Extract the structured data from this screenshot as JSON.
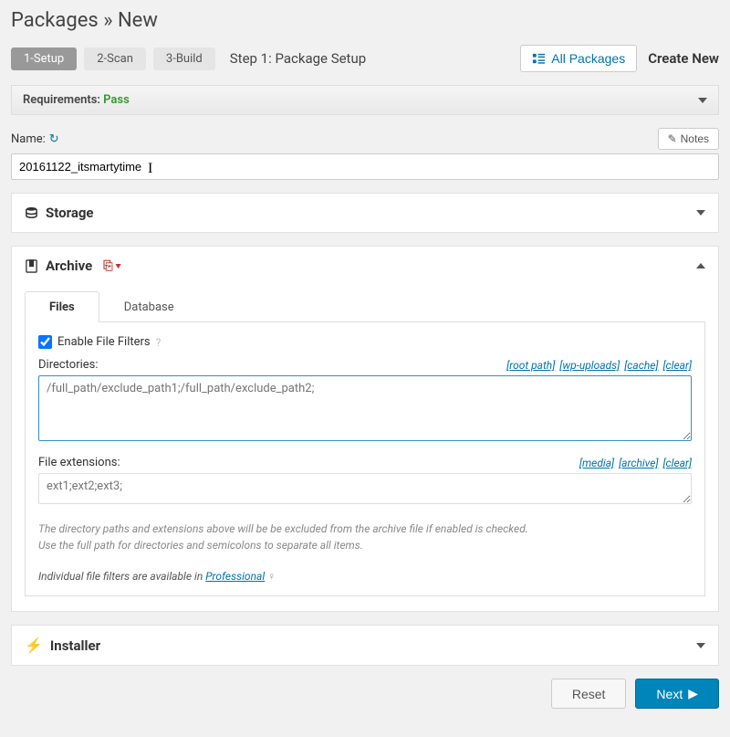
{
  "header": {
    "breadcrumb_root": "Packages",
    "breadcrumb_sep": "»",
    "breadcrumb_leaf": "New",
    "all_packages": "All Packages",
    "create_new": "Create New"
  },
  "steps": {
    "s1": "1-Setup",
    "s2": "2-Scan",
    "s3": "3-Build",
    "label": "Step 1: Package Setup"
  },
  "requirements": {
    "label": "Requirements: ",
    "status": "Pass"
  },
  "name": {
    "label": "Name:",
    "value": "20161122_itsmartytime",
    "notes_btn": "Notes"
  },
  "storage": {
    "title": "Storage"
  },
  "archive": {
    "title": "Archive",
    "tabs": {
      "files": "Files",
      "database": "Database"
    },
    "enable_filters": "Enable File Filters",
    "directories": {
      "label": "Directories:",
      "links": {
        "root": "[root path]",
        "wp": "[wp-uploads]",
        "cache": "[cache]",
        "clear": "[clear]"
      },
      "placeholder": "/full_path/exclude_path1;/full_path/exclude_path2;"
    },
    "extensions": {
      "label": "File extensions:",
      "links": {
        "media": "[media]",
        "archive": "[archive]",
        "clear": "[clear]"
      },
      "placeholder": "ext1;ext2;ext3;"
    },
    "note1": "The directory paths and extensions above will be be excluded from the archive file if enabled is checked.",
    "note2": "Use the full path for directories and semicolons to separate all items.",
    "filters_note_pre": "Individual file filters are available in ",
    "filters_note_link": "Professional"
  },
  "installer": {
    "title": "Installer"
  },
  "footer": {
    "reset": "Reset",
    "next": "Next"
  }
}
